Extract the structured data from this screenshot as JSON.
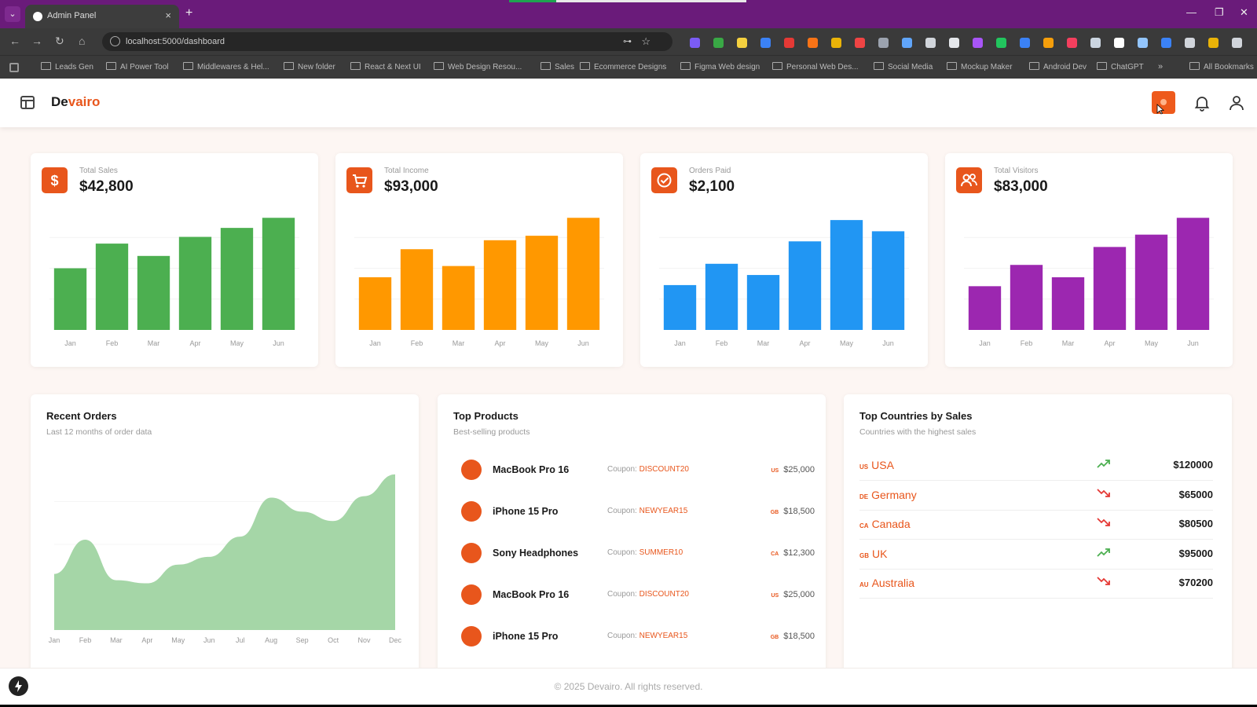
{
  "browser": {
    "tab_title": "Admin Panel",
    "tab_close": "×",
    "new_tab": "+",
    "url": "localhost:5000/dashboard",
    "bookmarks": [
      "Leads Gen",
      "AI Power Tool",
      "Middlewares & Hel...",
      "New folder",
      "React & Next UI",
      "Web Design Resou...",
      "Sales",
      "Ecommerce Designs",
      "Figma Web design",
      "Personal Web Des...",
      "Social Media",
      "Mockup Maker",
      "Android Dev",
      "ChatGPT"
    ],
    "all_bookmarks": "All Bookmarks"
  },
  "app": {
    "brand_prefix": "De",
    "brand_suffix": "vairo"
  },
  "stats": [
    {
      "label": "Total Sales",
      "value": "$42,800",
      "color": "#4caf50",
      "icon": "dollar-icon"
    },
    {
      "label": "Total Income",
      "value": "$93,000",
      "color": "#ff9800",
      "icon": "cart-icon"
    },
    {
      "label": "Orders Paid",
      "value": "$2,100",
      "color": "#2196f3",
      "icon": "check-circle-icon"
    },
    {
      "label": "Total Visitors",
      "value": "$83,000",
      "color": "#9c27b0",
      "icon": "users-icon"
    }
  ],
  "chart_data": [
    {
      "type": "bar",
      "categories": [
        "Jan",
        "Feb",
        "Mar",
        "Apr",
        "May",
        "Jun"
      ],
      "values": [
        55,
        77,
        66,
        83,
        91,
        100
      ],
      "ylim": [
        0,
        110
      ]
    },
    {
      "type": "bar",
      "categories": [
        "Jan",
        "Feb",
        "Mar",
        "Apr",
        "May",
        "Jun"
      ],
      "values": [
        47,
        72,
        57,
        80,
        84,
        100
      ],
      "ylim": [
        0,
        110
      ]
    },
    {
      "type": "bar",
      "categories": [
        "Jan",
        "Feb",
        "Mar",
        "Apr",
        "May",
        "Jun"
      ],
      "values": [
        40,
        59,
        49,
        79,
        98,
        88
      ],
      "ylim": [
        0,
        110
      ]
    },
    {
      "type": "bar",
      "categories": [
        "Jan",
        "Feb",
        "Mar",
        "Apr",
        "May",
        "Jun"
      ],
      "values": [
        39,
        58,
        47,
        74,
        85,
        100
      ],
      "ylim": [
        0,
        110
      ]
    },
    {
      "type": "area",
      "title": "Recent Orders",
      "categories": [
        "Jan",
        "Feb",
        "Mar",
        "Apr",
        "May",
        "Jun",
        "Jul",
        "Aug",
        "Sep",
        "Oct",
        "Nov",
        "Dec"
      ],
      "values": [
        36,
        58,
        32,
        30,
        42,
        47,
        60,
        85,
        76,
        70,
        86,
        100
      ],
      "color": "#a5d6a7",
      "ylim": [
        0,
        110
      ]
    }
  ],
  "recent_orders": {
    "title": "Recent Orders",
    "subtitle": "Last 12 months of order data"
  },
  "top_products": {
    "title": "Top Products",
    "subtitle": "Best-selling products",
    "coupon_label": "Coupon:",
    "items": [
      {
        "name": "MacBook Pro 16",
        "coupon": "DISCOUNT20",
        "country": "US",
        "price": "$25,000"
      },
      {
        "name": "iPhone 15 Pro",
        "coupon": "NEWYEAR15",
        "country": "GB",
        "price": "$18,500"
      },
      {
        "name": "Sony Headphones",
        "coupon": "SUMMER10",
        "country": "CA",
        "price": "$12,300"
      },
      {
        "name": "MacBook Pro 16",
        "coupon": "DISCOUNT20",
        "country": "US",
        "price": "$25,000"
      },
      {
        "name": "iPhone 15 Pro",
        "coupon": "NEWYEAR15",
        "country": "GB",
        "price": "$18,500"
      }
    ]
  },
  "top_countries": {
    "title": "Top Countries by Sales",
    "subtitle": "Countries with the highest sales",
    "items": [
      {
        "code": "US",
        "name": "USA",
        "trend": "up",
        "amount": "$120000"
      },
      {
        "code": "DE",
        "name": "Germany",
        "trend": "down",
        "amount": "$65000"
      },
      {
        "code": "CA",
        "name": "Canada",
        "trend": "down",
        "amount": "$80500"
      },
      {
        "code": "GB",
        "name": "UK",
        "trend": "up",
        "amount": "$95000"
      },
      {
        "code": "AU",
        "name": "Australia",
        "trend": "down",
        "amount": "$70200"
      }
    ]
  },
  "colors": {
    "accent": "#e8561c",
    "trend_up": "#4caf50",
    "trend_down": "#e53935"
  },
  "footer": {
    "text": "© 2025 Devairo. All rights reserved."
  }
}
